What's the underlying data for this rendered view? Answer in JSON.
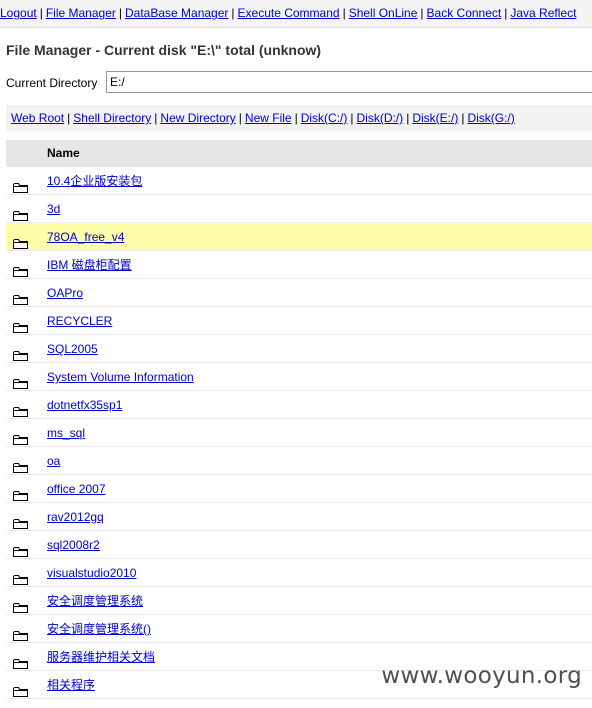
{
  "topnav": {
    "links": [
      "Logout",
      "File Manager",
      "DataBase Manager",
      "Execute Command",
      "Shell OnLine",
      "Back Connect",
      "Java Reflect"
    ]
  },
  "title": "File Manager - Current disk \"E:\\\" total (unknow)",
  "current_directory": {
    "label": "Current Directory",
    "value": "E:/"
  },
  "shortcuts": [
    "Web Root",
    "Shell Directory",
    "New Directory",
    "New File",
    "Disk(C:/)",
    "Disk(D:/)",
    "Disk(E:/)",
    "Disk(G:/)"
  ],
  "table": {
    "header": "Name",
    "highlight_color": "#ffffaa",
    "rows": [
      "10.4企业版安装包",
      "3d",
      "78OA_free_v4",
      "IBM 磁盘柜配置",
      "OAPro",
      "RECYCLER",
      "SQL2005",
      "System Volume Information",
      "dotnetfx35sp1",
      "ms_sql",
      "oa",
      "office 2007",
      "rav2012gq",
      "sql2008r2",
      "visualstudio2010",
      "安全调度管理系统",
      "安全调度管理系统()",
      "服务器维护相关文档",
      "相关程序"
    ],
    "highlighted_row": "78OA_free_v4"
  },
  "watermark": "www.wooyun.org"
}
